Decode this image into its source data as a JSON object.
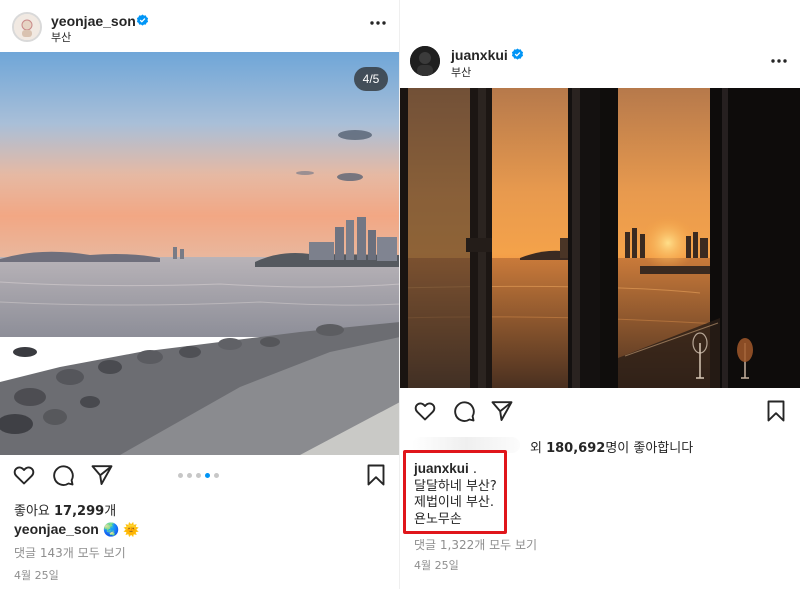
{
  "left_post": {
    "username": "yeonjae_son",
    "location": "부산",
    "counter": "4/5",
    "likes_prefix": "좋아요 ",
    "likes_count": "17,299",
    "likes_suffix": "개",
    "caption_user": "yeonjae_son",
    "caption_text": "🌏 🌞",
    "comments_link": "댓글 143개 모두 보기",
    "date": "4월 25일",
    "carousel": {
      "total": 5,
      "active_index": 3
    }
  },
  "right_post": {
    "username": "juanxkui",
    "location": "부산",
    "likes_prefix": "외 ",
    "likes_count": "180,692",
    "likes_suffix": "명이 좋아합니다",
    "caption_user": "juanxkui",
    "caption_user_suffix": " .",
    "caption_line2": "달달하네 부산?",
    "caption_line3": "제법이네 부산.",
    "caption_line4": "욘노무손",
    "comments_link": "댓글 1,322개 모두 보기",
    "date": "4월 25일"
  },
  "icons": {
    "verified": "verified-badge-icon",
    "more": "more-options-icon",
    "like": "heart-icon",
    "comment": "comment-icon",
    "share": "send-icon",
    "save": "bookmark-icon"
  },
  "colors": {
    "verified_blue": "#0095f6",
    "highlight_red": "#e0161b",
    "muted_gray": "#8e8e8e"
  }
}
